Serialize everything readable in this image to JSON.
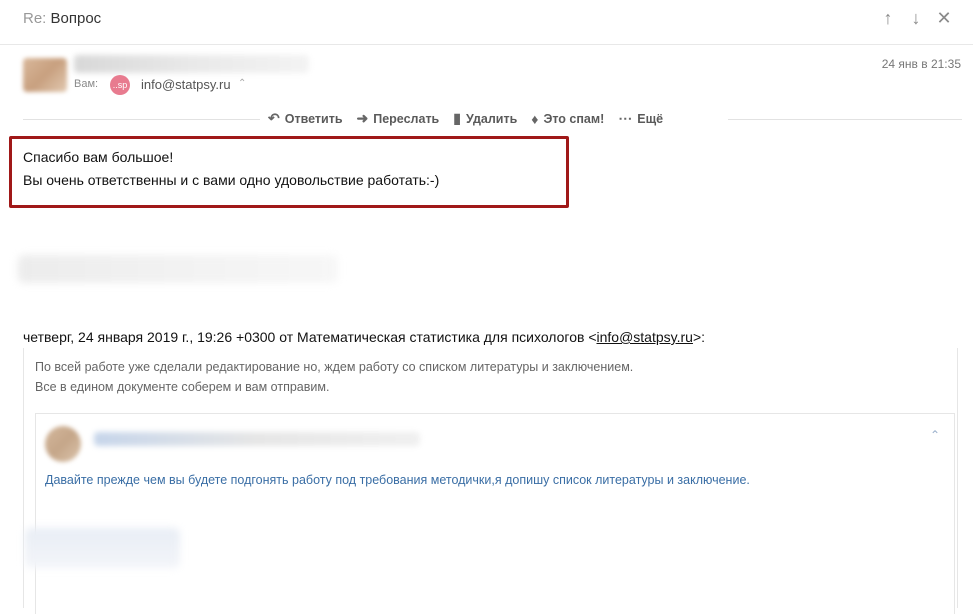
{
  "header": {
    "subject_prefix": "Re:",
    "subject": "Вопрос",
    "icons": [
      "arrow-up-icon",
      "arrow-down-icon",
      "close-icon"
    ]
  },
  "sender": {
    "to_label": "Вам:",
    "to_avatar_text": "..sp",
    "to_email": "info@statpsy.ru",
    "date": "24 янв в 21:35"
  },
  "actions": [
    {
      "label": "Ответить",
      "icon": "reply-icon"
    },
    {
      "label": "Переслать",
      "icon": "forward-icon"
    },
    {
      "label": "Удалить",
      "icon": "trash-icon"
    },
    {
      "label": "Это спам!",
      "icon": "fire-icon"
    },
    {
      "label": "Ещё",
      "icon": "more-dots-icon"
    }
  ],
  "message": {
    "line1": "Спасибо вам большое!",
    "line2": "Вы очень ответственны и с вами одно удовольствие работать:-)"
  },
  "quote": {
    "header_prefix": "четверг, 24 января 2019 г., 19:26 +0300 от Математическая статистика для психологов <",
    "header_email": "info@statpsy.ru",
    "header_suffix": ">:",
    "text1": "По всей работе уже сделали редактирование но, ждем работу со списком литературы и заключением.",
    "text2": "Все в едином документе соберем и вам отправим.",
    "inner_message": "Давайте прежде чем вы будете подгонять работу под требования методички,я допишу список литературы и заключение."
  },
  "colors": {
    "highlight_border": "#a01818",
    "link_blue": "#3a6ea5",
    "avatar_pink": "#e87b8f"
  }
}
